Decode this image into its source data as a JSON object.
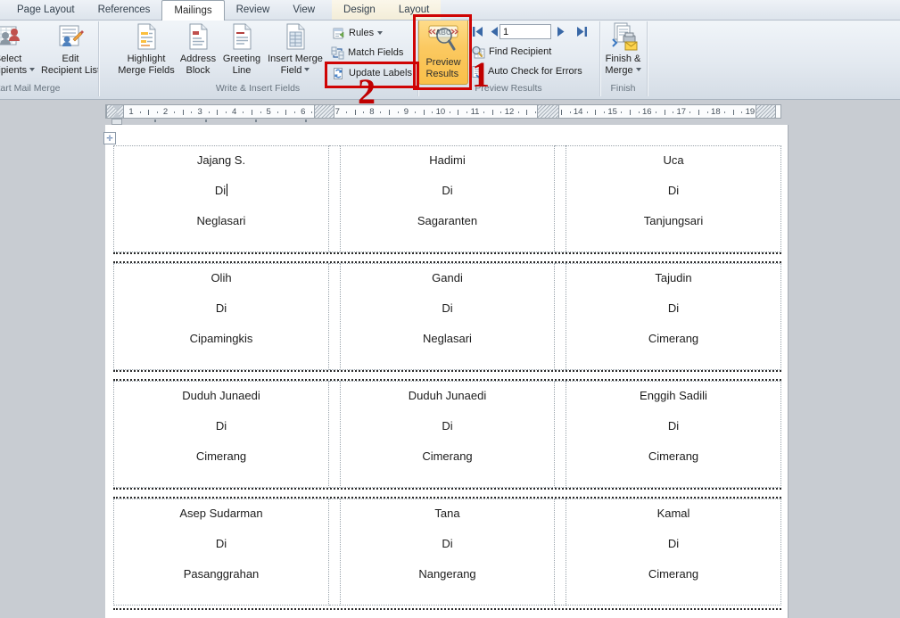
{
  "colors": {
    "annotation_red": "#cf0404",
    "preview_active_bg": "#fbc961",
    "document_bg": "#c8ccd2",
    "nav_arrow_blue": "#3968a6"
  },
  "tab_bar": {
    "tabs": [
      {
        "label": "Page Layout",
        "active": false,
        "contextual": false
      },
      {
        "label": "References",
        "active": false,
        "contextual": false
      },
      {
        "label": "Mailings",
        "active": true,
        "contextual": false
      },
      {
        "label": "Review",
        "active": false,
        "contextual": false
      },
      {
        "label": "View",
        "active": false,
        "contextual": false
      },
      {
        "label": "Design",
        "active": false,
        "contextual": true
      },
      {
        "label": "Layout",
        "active": false,
        "contextual": true
      }
    ]
  },
  "ribbon": {
    "start_mail_merge": {
      "group_label": "Start Mail Merge",
      "select_recipients": {
        "line1": "Select",
        "line2": "Recipients"
      },
      "edit_recipient_list": {
        "line1": "Edit",
        "line2": "Recipient List"
      }
    },
    "write_insert_fields": {
      "group_label": "Write & Insert Fields",
      "highlight_merge_fields": {
        "line1": "Highlight",
        "line2": "Merge Fields"
      },
      "address_block": {
        "line1": "Address",
        "line2": "Block"
      },
      "greeting_line": {
        "line1": "Greeting",
        "line2": "Line"
      },
      "insert_merge_field": {
        "line1": "Insert Merge",
        "line2": "Field"
      },
      "rules": "Rules",
      "match_fields": "Match Fields",
      "update_labels": "Update Labels"
    },
    "preview_results_group": {
      "group_label": "Preview Results",
      "preview_results": {
        "line1": "Preview",
        "line2": "Results"
      },
      "record_number": "1",
      "find_recipient": "Find Recipient",
      "auto_check": "Auto Check for Errors"
    },
    "finish_group": {
      "group_label": "Finish",
      "finish_merge": {
        "line1": "Finish &",
        "line2": "Merge"
      }
    }
  },
  "annotations": {
    "step_1": "1",
    "step_2": "2"
  },
  "icons": {
    "preview_results_glyph": "ABC"
  },
  "ruler": {
    "unit": "cm",
    "numbers": [
      1,
      2,
      3,
      4,
      5,
      6,
      7,
      8,
      9,
      10,
      11,
      12,
      13,
      14,
      15,
      16,
      17,
      18,
      19
    ]
  },
  "document": {
    "rows": [
      {
        "cells": [
          {
            "name": "Jajang S.",
            "di": "Di",
            "place": "Neglasari"
          },
          {
            "name": "Hadimi",
            "di": "Di",
            "place": "Sagaranten"
          },
          {
            "name": "Uca",
            "di": "Di",
            "place": "Tanjungsari"
          }
        ]
      },
      {
        "cells": [
          {
            "name": "Olih",
            "di": "Di",
            "place": "Cipamingkis"
          },
          {
            "name": "Gandi",
            "di": "Di",
            "place": "Neglasari"
          },
          {
            "name": "Tajudin",
            "di": "Di",
            "place": "Cimerang"
          }
        ]
      },
      {
        "cells": [
          {
            "name": "Duduh Junaedi",
            "di": "Di",
            "place": "Cimerang"
          },
          {
            "name": "Duduh Junaedi",
            "di": "Di",
            "place": "Cimerang"
          },
          {
            "name": "Enggih Sadili",
            "di": "Di",
            "place": "Cimerang"
          }
        ]
      },
      {
        "cells": [
          {
            "name": "Asep Sudarman",
            "di": "Di",
            "place": "Pasanggrahan"
          },
          {
            "name": "Tana",
            "di": "Di",
            "place": "Nangerang"
          },
          {
            "name": "Kamal",
            "di": "Di",
            "place": "Cimerang"
          }
        ]
      }
    ]
  }
}
